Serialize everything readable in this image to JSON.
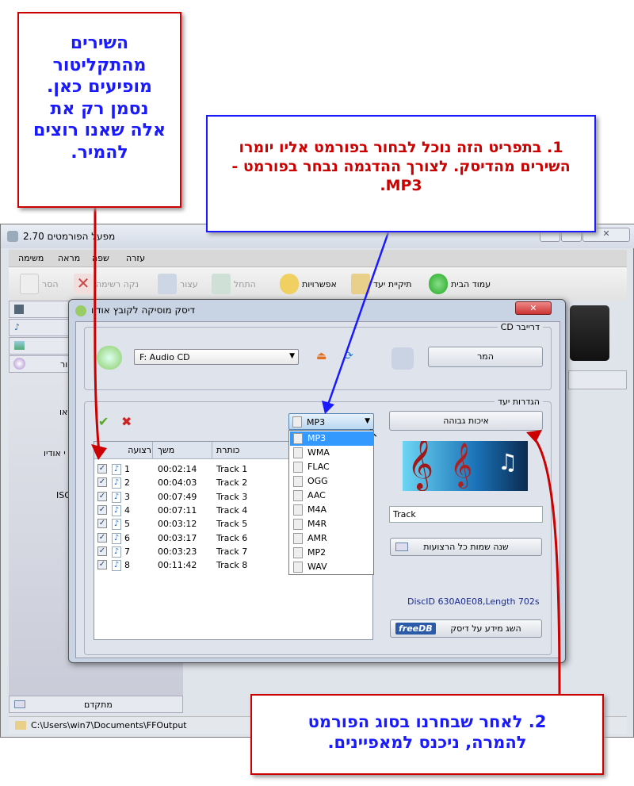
{
  "window": {
    "title": "מפעל הפורמטים 2.70",
    "menu": [
      "משימה",
      "מראה",
      "שפה",
      "עזרה"
    ],
    "toolbar": {
      "remove": "הסר",
      "clear_list": "נקה רשימה",
      "stop": "עצור",
      "start": "התחל",
      "options": "אפשרויות",
      "output_folder": "תיקיית יעד",
      "home": "עמוד הבית"
    },
    "sidebar": {
      "fragments": [
        "או",
        "י אודיו",
        "ISO",
        "ור"
      ],
      "advanced": "מתקדם"
    },
    "status_path": "C:\\Users\\win7\\Documents\\FFOutput"
  },
  "dialog": {
    "title": "דיסק מוסיקה לקובץ אודיו",
    "cd_group": "דרייבר CD",
    "drive": "F:  Audio CD",
    "convert": "המר",
    "output_group": "הגדרות יעד",
    "columns": {
      "track": "רצועה",
      "duration": "משך",
      "title": "כותרת"
    },
    "tracks": [
      {
        "n": "1",
        "duration": "00:02:14",
        "title": "Track 1"
      },
      {
        "n": "2",
        "duration": "00:04:03",
        "title": "Track 2"
      },
      {
        "n": "3",
        "duration": "00:07:49",
        "title": "Track 3"
      },
      {
        "n": "4",
        "duration": "00:07:11",
        "title": "Track 4"
      },
      {
        "n": "5",
        "duration": "00:03:12",
        "title": "Track 5"
      },
      {
        "n": "6",
        "duration": "00:03:17",
        "title": "Track 6"
      },
      {
        "n": "7",
        "duration": "00:03:23",
        "title": "Track 7"
      },
      {
        "n": "8",
        "duration": "00:11:42",
        "title": "Track 8"
      }
    ],
    "format_selected": "MP3",
    "formats": [
      "MP3",
      "WMA",
      "FLAC",
      "OGG",
      "AAC",
      "M4A",
      "M4R",
      "AMR",
      "MP2",
      "WAV"
    ],
    "quality": "איכות גבוהה",
    "name_value": "Track",
    "rename_all": "שנה שמות כל הרצועות",
    "disc_info": "DiscID 630A0E08,Length 702s",
    "get_info": "השג מידע על דיסק",
    "freedb_logo": "freeDB"
  },
  "callouts": {
    "left": "השירים מהתקליטור מופיעים כאן. נסמן רק את אלה שאנו רוצים להמיר.",
    "top": "1. בתפריט הזה נוכל לבחור בפורמט אליו יומרו השירים מהדיסק. לצורך ההדגמה נבחר בפורמט - MP3.",
    "bottom": "2. לאחר שבחרנו בסוג הפורמט להמרה, ניכנס למאפיינים."
  },
  "colors": {
    "callout_blue": "#1a1aff",
    "callout_red": "#cc0000",
    "selection": "#3399ff"
  }
}
